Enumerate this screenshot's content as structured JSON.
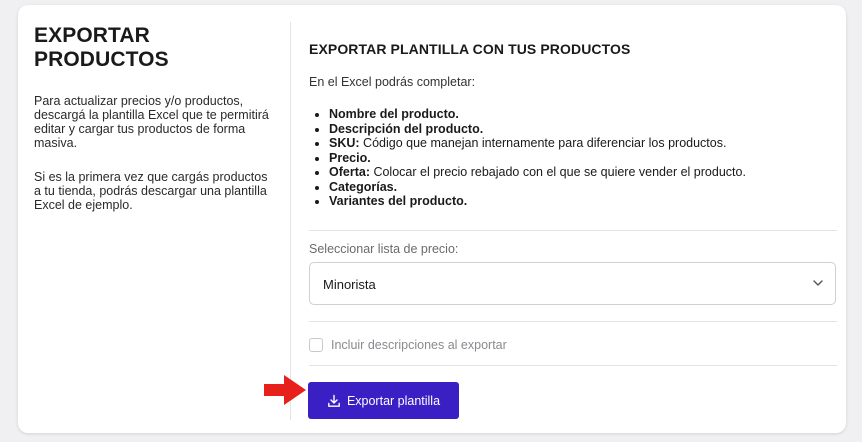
{
  "left": {
    "title": "EXPORTAR PRODUCTOS",
    "paragraph1": "Para actualizar precios y/o productos, descargá la plantilla Excel que te permitirá editar y cargar tus productos de forma masiva.",
    "paragraph2": "Si es la primera vez que cargás productos a tu tienda, podrás descargar una plantilla Excel de ejemplo."
  },
  "right": {
    "title": "EXPORTAR PLANTILLA CON TUS PRODUCTOS",
    "intro": "En el Excel podrás completar:",
    "items": [
      {
        "bold": "Nombre del producto.",
        "text": ""
      },
      {
        "bold": "Descripción del producto.",
        "text": ""
      },
      {
        "bold": "SKU:",
        "text": " Código que manejan internamente para diferenciar los productos."
      },
      {
        "bold": "Precio.",
        "text": ""
      },
      {
        "bold": "Oferta:",
        "text": " Colocar el precio rebajado con el que se quiere vender el producto."
      },
      {
        "bold": "Categorías.",
        "text": ""
      },
      {
        "bold": "Variantes del producto.",
        "text": ""
      }
    ],
    "select_label": "Seleccionar lista de precio:",
    "select_value": "Minorista",
    "checkbox_label": "Incluir descripciones al exportar",
    "checkbox_checked": false,
    "export_button": "Exportar plantilla"
  },
  "icons": {
    "select": "chevron-down-icon",
    "button": "download-icon",
    "annotation": "red-arrow-icon"
  },
  "colors": {
    "button": "#3a1fc4",
    "annotation_arrow": "#e8201c"
  }
}
